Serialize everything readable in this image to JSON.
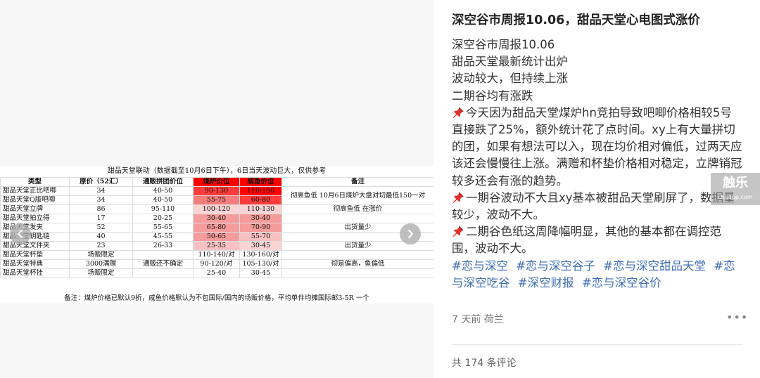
{
  "sheet": {
    "title": "甜品天堂联动（数据截至10月6日下午），6日当天波动巨大，仅供参考",
    "headers": [
      "类型",
      "原价（52汇）",
      "通贩拼团价位",
      "煤炉价位",
      "咸鱼价位",
      "备注"
    ],
    "rows": [
      {
        "type": "甜品天堂正比吧唧",
        "price": "34",
        "group": "40-50",
        "mercari": "90-130",
        "xianyu": "110-150"
      },
      {
        "type": "甜品天堂Q版吧唧",
        "price": "34",
        "group": "40-50",
        "mercari": "55-75",
        "xianyu": "60-80"
      },
      {
        "type": "甜品天堂立牌",
        "price": "86",
        "group": "95-110",
        "mercari": "100-120",
        "xianyu": "110-130"
      },
      {
        "type": "甜品天堂拍立得",
        "price": "17",
        "group": "20-25",
        "mercari": "30-40",
        "xianyu": "30-40"
      },
      {
        "type": "甜品天堂发夹",
        "price": "52",
        "group": "55-65",
        "mercari": "65-80",
        "xianyu": "70-90"
      },
      {
        "type": "甜品天堂钥匙链",
        "price": "40",
        "group": "45-55",
        "mercari": "50-65",
        "xianyu": "55-70"
      },
      {
        "type": "甜品天堂文件夹",
        "price": "23",
        "group": "26-33",
        "mercari": "25-35",
        "xianyu": "30-45"
      },
      {
        "type": "甜品天堂杯垫",
        "price": "场贩限定",
        "group": "",
        "mercari": "110-140/对",
        "xianyu": "130-160/对"
      },
      {
        "type": "甜品天堂特典",
        "price": "3000满赠",
        "group": "通贩还不确定",
        "mercari": "90-120/对",
        "xianyu": "105-130/对"
      },
      {
        "type": "甜品天堂杯挂",
        "price": "场贩限定",
        "group": "",
        "mercari": "25-40",
        "xianyu": "30-45"
      }
    ],
    "notes": [
      "彻高鱼低 10月6日煤炉大盘对切最低150一对",
      "彻高鱼低  在涨价",
      "出货量少",
      "出货量少",
      "彻是偏高，鱼偏低"
    ],
    "footnote": "备注：煤炉价格已默认9折，咸鱼价格默认为不包国际/国内的场贩价格，平均单件均摊国际邮3-5R 一个",
    "heat_colors": [
      "#ff0000",
      "#ff3b3b",
      "#f47d7d",
      "#f59b9b",
      "#f9c1c1",
      "#fbd4d4",
      "#ffffff"
    ]
  },
  "viewer": {
    "prev_icon": "chevron-left-icon",
    "next_icon": "chevron-right-icon"
  },
  "article": {
    "title": "深空谷市周报10.06，甜品天堂心电图式涨价",
    "lines": [
      "深空谷市周报10.06",
      "甜品天堂最新统计出炉",
      "波动较大，但持续上涨",
      "二期谷均有涨跌"
    ],
    "paragraphs": [
      "今天因为甜品天堂煤炉hn竞拍导致吧唧价格相较5号直接跌了25%，额外统计花了点时间。xy上有大量拼切的团，如果有想法可以入，现在均价相对偏低，过两天应该还会慢慢往上涨。满赠和杯垫价格相对稳定，立牌销冠较多还会有涨的趋势。",
      "一期谷波动不大且xy基本被甜品天堂刷屏了，数据量较少，波动不大。",
      "二期谷色纸这周降幅明显，其他的基本都在调控范围，波动不大。"
    ],
    "pin_icon": "pushpin-icon",
    "tags": [
      "#恋与深空",
      "#恋与深空谷子",
      "#恋与深空甜品天堂",
      "#恋与深空吃谷",
      "#深空财报",
      "#恋与深空谷价"
    ],
    "meta": "7 天前 荷兰",
    "more_icon": "more-dots-icon",
    "comments": "共 174 条评论"
  },
  "watermark": {
    "main": "触乐",
    "sub": "chuapp.com"
  }
}
